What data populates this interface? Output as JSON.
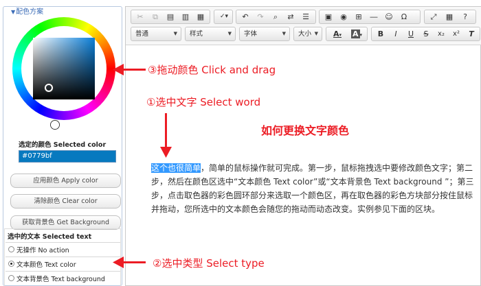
{
  "scheme": {
    "legend": "配色方案",
    "selected_color_label": "选定的颜色 Selected color",
    "selected_color_value": "#0779bf",
    "buttons": {
      "apply": "应用颜色 Apply color",
      "clear": "清除颜色 Clear color",
      "get_bg": "获取背景色 Get Background"
    },
    "selected_text": {
      "title": "选中的文本 Selected text",
      "options": [
        {
          "label": "无操作 No action",
          "checked": false
        },
        {
          "label": "文本颜色 Text color",
          "checked": true
        },
        {
          "label": "文本背景色 Text background",
          "checked": false
        }
      ]
    }
  },
  "toolbar": {
    "combos": {
      "format": "普通",
      "style": "样式",
      "font": "字体",
      "size": "大小"
    },
    "glyphs": {
      "text_color": "A",
      "bg_color": "A",
      "bold": "B",
      "italic": "I",
      "underline": "U",
      "strike": "S",
      "subscript": "x₂",
      "superscript": "x²",
      "clear_format": "T"
    }
  },
  "content": {
    "highlighted": "这个也很简单",
    "body": "，简单的鼠标操作就可完成。第一步，鼠标拖拽选中要修改颜色文字；第二步，然后在颜色区选中“文本颜色 Text color”或“文本背景色 Text background ”；第三步，点击取色器的彩色圆环部分来选取一个颜色区，再在取色器的彩色方块部分按住鼠标并拖动，您所选中的文本颜色会随您的拖动而动态改变。实例参见下面的区块。"
  },
  "annotations": {
    "drag": "③拖动颜色 Click and drag",
    "select_word": "①选中文字 Select word",
    "how_to": "如何更换文字颜色",
    "select_type": "②选中类型 Select type"
  },
  "colors": {
    "accent_red": "#ec1c24",
    "selected_color": "#0779bf",
    "legend_blue": "#3b6cb7"
  }
}
